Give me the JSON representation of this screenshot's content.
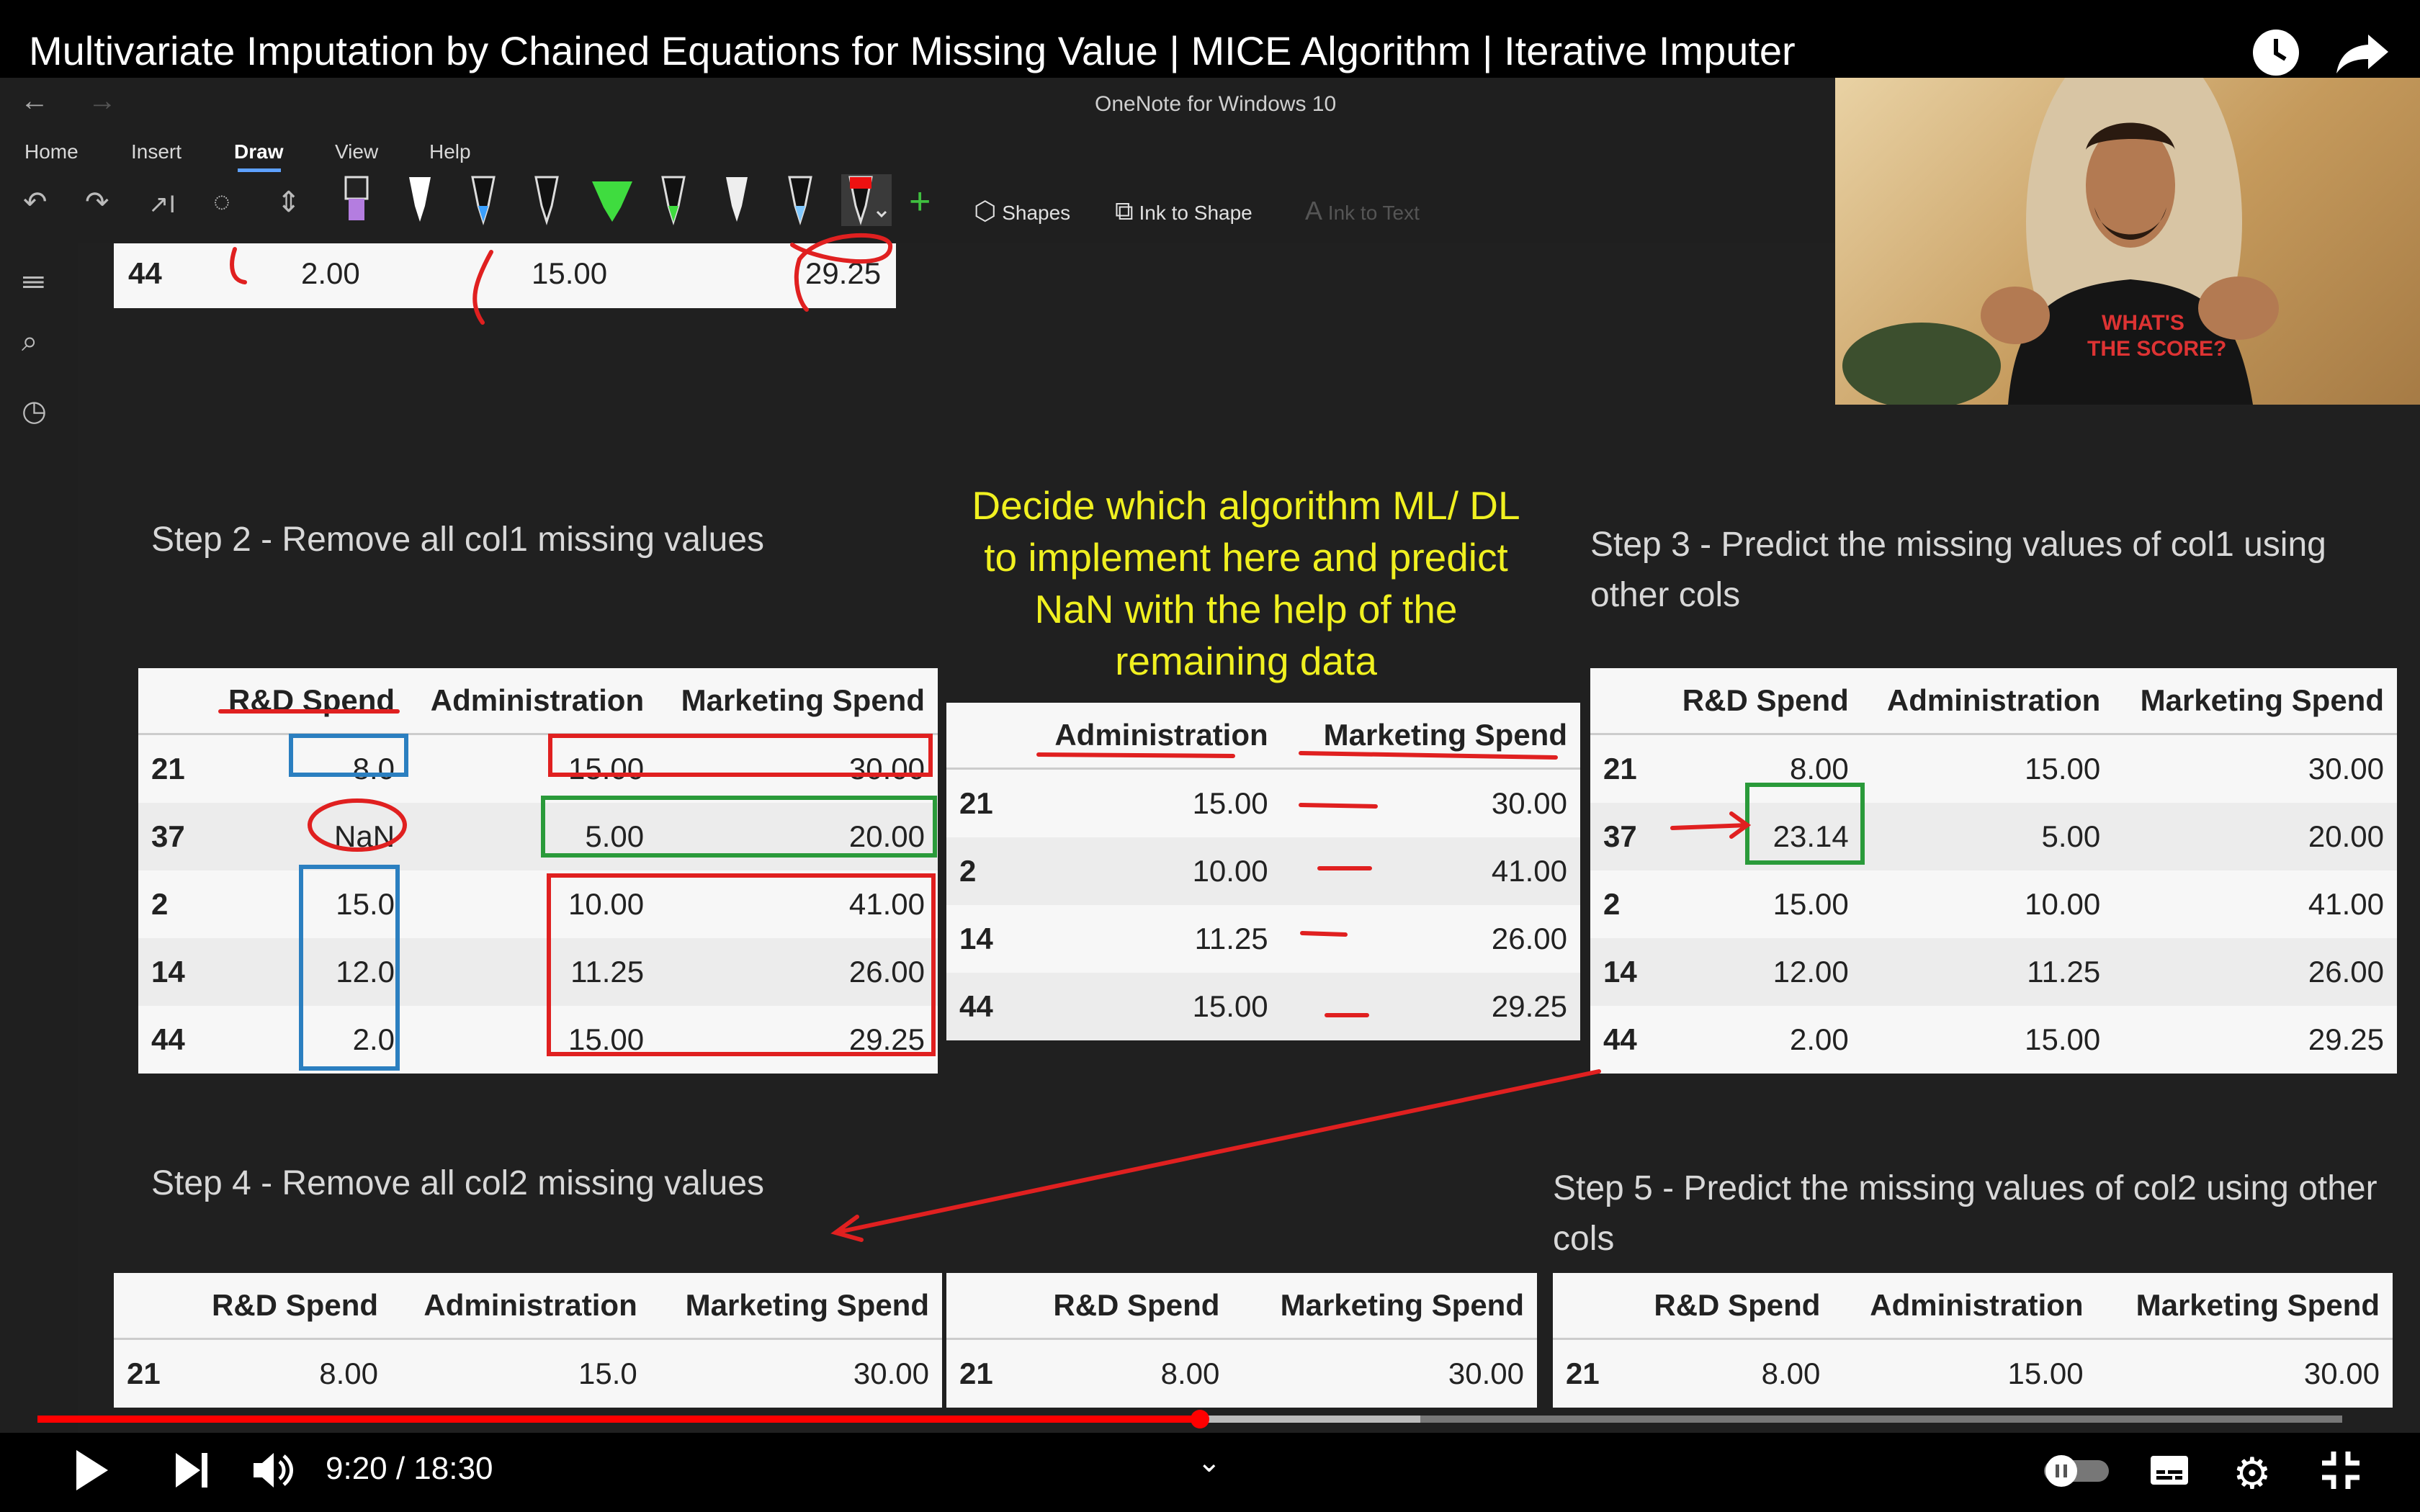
{
  "video": {
    "title": "Multivariate Imputation by Chained Equations for Missing Value | MICE Algorithm | Iterative Imputer",
    "time": "9:20 / 18:30",
    "progress": 0.5045
  },
  "app": {
    "title": "OneNote for Windows 10",
    "menu": [
      "Home",
      "Insert",
      "Draw",
      "View",
      "Help"
    ],
    "tools": {
      "shapes": "Shapes",
      "ink_to_shape": "Ink to Shape",
      "ink_to_text": "Ink to Text"
    }
  },
  "top_row": {
    "index": "44",
    "c1": "2.00",
    "c2": "15.00",
    "c3": "29.25"
  },
  "steps": {
    "step2": "Step 2 - Remove all col1 missing values",
    "step3": "Step 3 - Predict the missing values of col1 using other cols",
    "step4": "Step 4 - Remove all col2 missing values",
    "step5": "Step 5 - Predict the missing values of col2 using other cols"
  },
  "note": "Decide which algorithm ML/ DL to implement here and predict NaN with the help of the remaining data",
  "tables": {
    "t2": {
      "headers": [
        "R&D Spend",
        "Administration",
        "Marketing Spend"
      ],
      "rows": [
        [
          "21",
          "8.0",
          "15.00",
          "30.00"
        ],
        [
          "37",
          "NaN",
          "5.00",
          "20.00"
        ],
        [
          "2",
          "15.0",
          "10.00",
          "41.00"
        ],
        [
          "14",
          "12.0",
          "11.25",
          "26.00"
        ],
        [
          "44",
          "2.0",
          "15.00",
          "29.25"
        ]
      ]
    },
    "tmid": {
      "headers": [
        "Administration",
        "Marketing Spend"
      ],
      "rows": [
        [
          "21",
          "15.00",
          "30.00"
        ],
        [
          "2",
          "10.00",
          "41.00"
        ],
        [
          "14",
          "11.25",
          "26.00"
        ],
        [
          "44",
          "15.00",
          "29.25"
        ]
      ]
    },
    "t3": {
      "headers": [
        "R&D Spend",
        "Administration",
        "Marketing Spend"
      ],
      "rows": [
        [
          "21",
          "8.00",
          "15.00",
          "30.00"
        ],
        [
          "37",
          "23.14",
          "5.00",
          "20.00"
        ],
        [
          "2",
          "15.00",
          "10.00",
          "41.00"
        ],
        [
          "14",
          "12.00",
          "11.25",
          "26.00"
        ],
        [
          "44",
          "2.00",
          "15.00",
          "29.25"
        ]
      ]
    },
    "t4": {
      "headers": [
        "R&D Spend",
        "Administration",
        "Marketing Spend"
      ],
      "rows": [
        [
          "21",
          "8.00",
          "15.0",
          "30.00"
        ]
      ]
    },
    "t4b": {
      "headers": [
        "R&D Spend",
        "Marketing Spend"
      ],
      "rows": [
        [
          "21",
          "8.00",
          "30.00"
        ]
      ]
    },
    "t5": {
      "headers": [
        "R&D Spend",
        "Administration",
        "Marketing Spend"
      ],
      "rows": [
        [
          "21",
          "8.00",
          "15.00",
          "30.00"
        ]
      ]
    }
  },
  "webcam_shirt_text": "WHAT'S\nTHE SCORE?"
}
